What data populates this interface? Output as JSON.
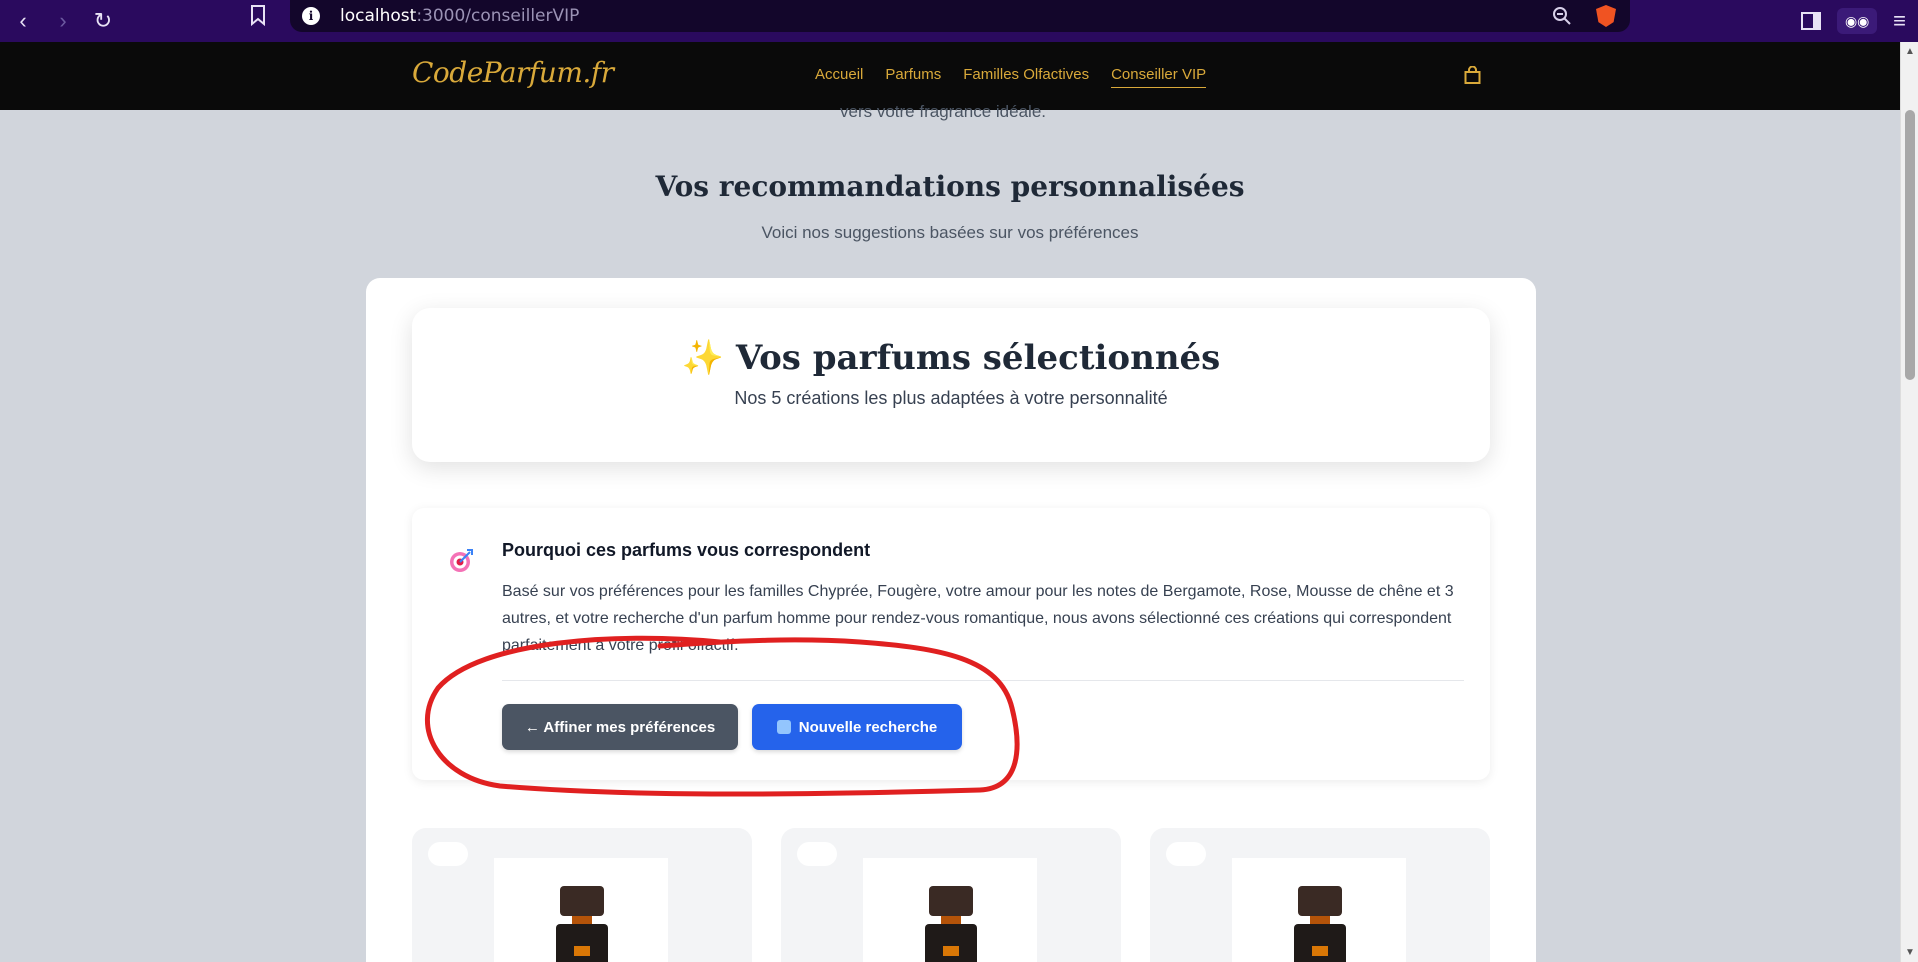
{
  "browser": {
    "url_host": "localhost",
    "url_path": ":3000/conseillerVIP"
  },
  "site": {
    "logo": "CodeParfum.fr",
    "nav": [
      "Accueil",
      "Parfums",
      "Familles Olfactives",
      "Conseiller VIP"
    ],
    "active_nav": "Conseiller VIP"
  },
  "intro": {
    "cut_text": "vers votre fragrance idéale."
  },
  "section": {
    "title": "Vos recommandations personnalisées",
    "subtitle": "Voici nos suggestions basées sur vos préférences"
  },
  "selected": {
    "emoji": "✨",
    "title": "Vos parfums sélectionnés",
    "subtitle": "Nos 5 créations les plus adaptées à votre personnalité"
  },
  "why": {
    "title": "Pourquoi ces parfums vous correspondent",
    "text": "Basé sur vos préférences pour les familles Chyprée, Fougère, votre amour pour les notes de Bergamote, Rose, Mousse de chêne et 3 autres, et votre recherche d'un parfum homme pour rendez-vous romantique, nous avons sélectionné ces créations qui correspondent parfaitement à votre profil olfactif.",
    "refine_label": "← Affiner mes préférences",
    "new_search_label": "Nouvelle recherche"
  },
  "colors": {
    "gold": "#d9a93a",
    "primary_blue": "#2563eb",
    "slate_button": "#4b5563",
    "annotation_red": "#e02020"
  },
  "icons": [
    "back-icon",
    "forward-icon",
    "reload-icon",
    "bookmark-icon",
    "info-icon",
    "zoom-icon",
    "brave-icon",
    "sidebar-icon",
    "glasses-icon",
    "menu-icon",
    "cart-icon",
    "target-icon",
    "refresh-icon"
  ]
}
